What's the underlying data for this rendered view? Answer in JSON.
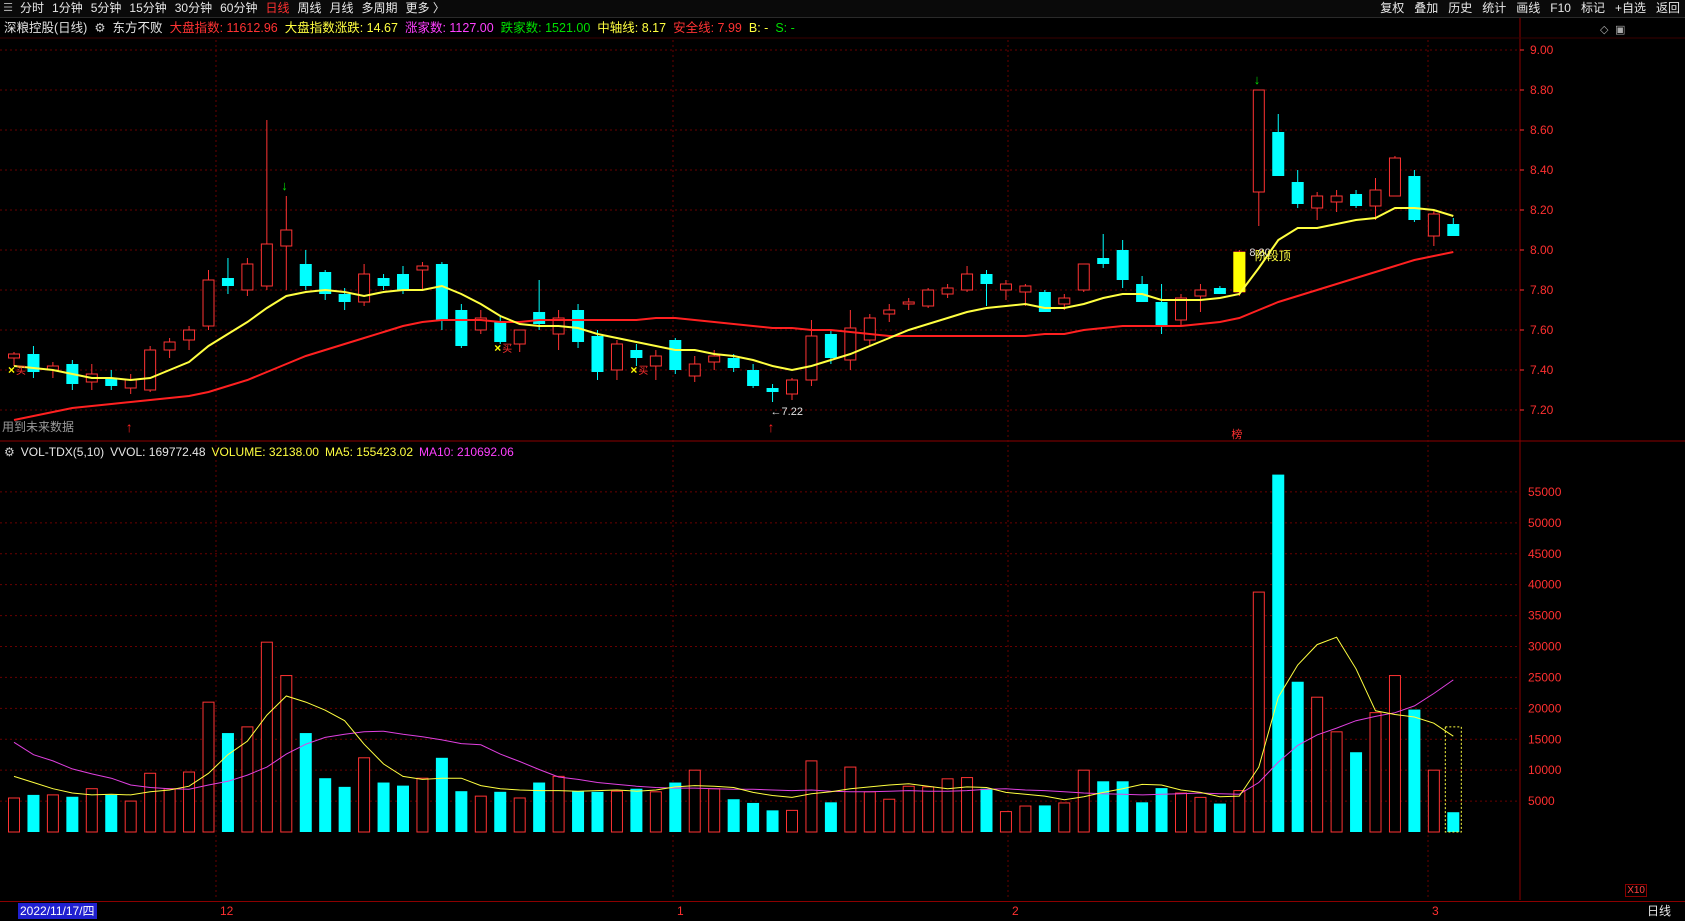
{
  "topbar": {
    "menu_icon": "menu-icon",
    "periods": [
      "分时",
      "1分钟",
      "5分钟",
      "15分钟",
      "30分钟",
      "60分钟",
      "日线",
      "周线",
      "月线",
      "多周期",
      "更多 〉"
    ],
    "active_period": "日线",
    "right_buttons": [
      "复权",
      "叠加",
      "历史",
      "统计",
      "画线",
      "F10",
      "标记",
      "+自选",
      "返回"
    ]
  },
  "infobar": {
    "stock": "深粮控股(日线)",
    "indicator": "东方不败",
    "index_label": "大盘指数: 11612.96",
    "index_change": "大盘指数涨跌: 14.67",
    "up_count": "涨家数: 1127.00",
    "down_count": "跌家数: 1521.00",
    "mid_line": "中轴线: 8.17",
    "safe_line": "安全线: 7.99",
    "b": "B: -",
    "s": "S: -"
  },
  "volbar": {
    "indicator": "VOL-TDX(5,10)",
    "vvol": "VVOL: 169772.48",
    "volume": "VOLUME: 32138.00",
    "ma5": "MA5: 155423.02",
    "ma10": "MA10: 210692.06"
  },
  "notes": {
    "future_data": "用到未来数据",
    "low_label": "←7.22",
    "high_label": "8.80",
    "stage_top": "阶段顶",
    "bang": "榜",
    "buy_marker": "买"
  },
  "bottombar": {
    "date": "2022/11/17/四",
    "ticks": [
      "12",
      "1",
      "2",
      "3"
    ],
    "period": "日线",
    "x10": "X10"
  },
  "price_axis": [
    "9.00",
    "8.80",
    "8.60",
    "8.40",
    "8.20",
    "8.00",
    "7.80",
    "7.60",
    "7.40",
    "7.20"
  ],
  "volume_axis": [
    "55000",
    "50000",
    "45000",
    "40000",
    "35000",
    "30000",
    "25000",
    "20000",
    "15000",
    "10000",
    "5000"
  ],
  "colors": {
    "up": "#ff3333",
    "down": "#00ffff",
    "ma_short": "#ffff40",
    "ma_long": "#ff2020",
    "vol_ma5": "#ffff40",
    "vol_ma10": "#e040e0",
    "grid": "#6a0000"
  },
  "chart_data": {
    "type": "candlestick",
    "price_range": [
      7.05,
      9.05
    ],
    "volume_range": [
      0,
      60000
    ],
    "candles": [
      [
        7.46,
        7.49,
        7.42,
        7.48,
        5500
      ],
      [
        7.48,
        7.52,
        7.36,
        7.39,
        6000
      ],
      [
        7.4,
        7.44,
        7.36,
        7.42,
        6000
      ],
      [
        7.43,
        7.45,
        7.3,
        7.33,
        5700
      ],
      [
        7.34,
        7.43,
        7.3,
        7.38,
        7000
      ],
      [
        7.36,
        7.4,
        7.3,
        7.32,
        6000
      ],
      [
        7.31,
        7.38,
        7.28,
        7.35,
        5000
      ],
      [
        7.3,
        7.52,
        7.29,
        7.5,
        9500
      ],
      [
        7.5,
        7.56,
        7.46,
        7.54,
        7000
      ],
      [
        7.55,
        7.62,
        7.5,
        7.6,
        9700
      ],
      [
        7.62,
        7.9,
        7.6,
        7.85,
        21000
      ],
      [
        7.86,
        7.96,
        7.78,
        7.82,
        16000
      ],
      [
        7.8,
        7.96,
        7.77,
        7.93,
        17000
      ],
      [
        7.82,
        8.65,
        7.8,
        8.03,
        30700
      ],
      [
        8.02,
        8.27,
        7.8,
        8.1,
        25300
      ],
      [
        7.93,
        8.0,
        7.8,
        7.82,
        16000
      ],
      [
        7.89,
        7.9,
        7.75,
        7.78,
        8700
      ],
      [
        7.78,
        7.81,
        7.7,
        7.74,
        7300
      ],
      [
        7.74,
        7.93,
        7.72,
        7.88,
        12000
      ],
      [
        7.86,
        7.88,
        7.8,
        7.82,
        8000
      ],
      [
        7.88,
        7.92,
        7.78,
        7.8,
        7500
      ],
      [
        7.9,
        7.94,
        7.8,
        7.92,
        8700
      ],
      [
        7.93,
        7.94,
        7.6,
        7.65,
        12000
      ],
      [
        7.7,
        7.73,
        7.51,
        7.52,
        6600
      ],
      [
        7.6,
        7.7,
        7.58,
        7.66,
        5800
      ],
      [
        7.64,
        7.67,
        7.53,
        7.54,
        6500
      ],
      [
        7.53,
        7.6,
        7.49,
        7.6,
        5500
      ],
      [
        7.69,
        7.85,
        7.6,
        7.63,
        8000
      ],
      [
        7.58,
        7.7,
        7.5,
        7.66,
        9000
      ],
      [
        7.7,
        7.73,
        7.51,
        7.54,
        6600
      ],
      [
        7.57,
        7.6,
        7.35,
        7.39,
        6500
      ],
      [
        7.4,
        7.55,
        7.35,
        7.53,
        6600
      ],
      [
        7.5,
        7.53,
        7.42,
        7.46,
        7000
      ],
      [
        7.42,
        7.5,
        7.35,
        7.47,
        6500
      ],
      [
        7.55,
        7.56,
        7.38,
        7.4,
        8000
      ],
      [
        7.37,
        7.47,
        7.34,
        7.43,
        10000
      ],
      [
        7.44,
        7.5,
        7.4,
        7.47,
        7000
      ],
      [
        7.46,
        7.48,
        7.39,
        7.41,
        5300
      ],
      [
        7.4,
        7.43,
        7.31,
        7.32,
        4700
      ],
      [
        7.31,
        7.33,
        7.24,
        7.29,
        3500
      ],
      [
        7.28,
        7.36,
        7.25,
        7.35,
        3500
      ],
      [
        7.35,
        7.65,
        7.32,
        7.57,
        11500
      ],
      [
        7.58,
        7.6,
        7.43,
        7.46,
        4800
      ],
      [
        7.45,
        7.7,
        7.4,
        7.61,
        10500
      ],
      [
        7.55,
        7.68,
        7.52,
        7.66,
        6500
      ],
      [
        7.68,
        7.73,
        7.64,
        7.7,
        5300
      ],
      [
        7.73,
        7.76,
        7.7,
        7.74,
        7400
      ],
      [
        7.72,
        7.81,
        7.71,
        7.8,
        7300
      ],
      [
        7.78,
        7.83,
        7.76,
        7.81,
        8600
      ],
      [
        7.8,
        7.92,
        7.79,
        7.88,
        8800
      ],
      [
        7.88,
        7.9,
        7.72,
        7.83,
        7000
      ],
      [
        7.8,
        7.85,
        7.75,
        7.83,
        3300
      ],
      [
        7.79,
        7.83,
        7.72,
        7.82,
        4200
      ],
      [
        7.79,
        7.8,
        7.7,
        7.69,
        4300
      ],
      [
        7.73,
        7.78,
        7.7,
        7.76,
        4700
      ],
      [
        7.8,
        7.92,
        7.79,
        7.93,
        10000
      ],
      [
        7.96,
        8.08,
        7.91,
        7.93,
        8200
      ],
      [
        8.0,
        8.05,
        7.81,
        7.85,
        8200
      ],
      [
        7.83,
        7.87,
        7.74,
        7.74,
        4800
      ],
      [
        7.74,
        7.83,
        7.58,
        7.62,
        7100
      ],
      [
        7.65,
        7.78,
        7.62,
        7.76,
        6300
      ],
      [
        7.77,
        7.83,
        7.69,
        7.8,
        5600
      ],
      [
        7.81,
        7.82,
        7.78,
        7.78,
        4600
      ],
      [
        7.79,
        8.0,
        7.77,
        7.99,
        6700
      ],
      [
        8.29,
        8.8,
        8.12,
        8.8,
        38800
      ],
      [
        8.59,
        8.68,
        8.37,
        8.37,
        57800
      ],
      [
        8.34,
        8.4,
        8.21,
        8.23,
        24300
      ],
      [
        8.21,
        8.29,
        8.15,
        8.27,
        21800
      ],
      [
        8.24,
        8.3,
        8.19,
        8.27,
        16200
      ],
      [
        8.28,
        8.3,
        8.21,
        8.22,
        12900
      ],
      [
        8.22,
        8.36,
        8.15,
        8.3,
        19300
      ],
      [
        8.27,
        8.47,
        8.27,
        8.46,
        25300
      ],
      [
        8.37,
        8.4,
        8.14,
        8.15,
        19800
      ],
      [
        8.07,
        8.2,
        8.02,
        8.18,
        10000
      ],
      [
        8.13,
        8.16,
        8.07,
        8.07,
        3200
      ]
    ],
    "ma_short": [
      7.42,
      7.41,
      7.4,
      7.38,
      7.36,
      7.36,
      7.35,
      7.36,
      7.4,
      7.44,
      7.52,
      7.58,
      7.64,
      7.71,
      7.77,
      7.79,
      7.8,
      7.79,
      7.77,
      7.79,
      7.8,
      7.8,
      7.82,
      7.78,
      7.73,
      7.67,
      7.63,
      7.62,
      7.62,
      7.61,
      7.58,
      7.56,
      7.54,
      7.52,
      7.5,
      7.5,
      7.48,
      7.47,
      7.45,
      7.42,
      7.4,
      7.42,
      7.45,
      7.48,
      7.52,
      7.56,
      7.6,
      7.63,
      7.66,
      7.69,
      7.71,
      7.72,
      7.73,
      7.71,
      7.71,
      7.73,
      7.76,
      7.78,
      7.78,
      7.75,
      7.75,
      7.75,
      7.76,
      7.78,
      7.91,
      8.05,
      8.11,
      8.11,
      8.13,
      8.15,
      8.16,
      8.21,
      8.21,
      8.2,
      8.17
    ],
    "ma_long": [
      7.15,
      7.17,
      7.19,
      7.21,
      7.22,
      7.23,
      7.24,
      7.25,
      7.26,
      7.27,
      7.29,
      7.32,
      7.35,
      7.39,
      7.43,
      7.47,
      7.5,
      7.53,
      7.56,
      7.59,
      7.62,
      7.64,
      7.65,
      7.65,
      7.65,
      7.64,
      7.64,
      7.65,
      7.65,
      7.65,
      7.65,
      7.65,
      7.65,
      7.66,
      7.66,
      7.65,
      7.64,
      7.63,
      7.62,
      7.61,
      7.61,
      7.6,
      7.6,
      7.59,
      7.58,
      7.57,
      7.57,
      7.57,
      7.57,
      7.57,
      7.57,
      7.57,
      7.57,
      7.58,
      7.58,
      7.6,
      7.61,
      7.62,
      7.62,
      7.62,
      7.62,
      7.63,
      7.64,
      7.66,
      7.7,
      7.74,
      7.77,
      7.8,
      7.83,
      7.86,
      7.89,
      7.92,
      7.95,
      7.97,
      7.99
    ],
    "vol_ma5": [
      9000,
      8000,
      7000,
      6300,
      6000,
      6100,
      6000,
      6500,
      6800,
      7400,
      9500,
      12500,
      14700,
      18900,
      22000,
      21000,
      19700,
      18000,
      14200,
      11000,
      9000,
      8500,
      8700,
      8700,
      7500,
      7000,
      6800,
      6700,
      6700,
      6600,
      6700,
      6800,
      6600,
      6800,
      7300,
      7500,
      7400,
      7200,
      6400,
      5900,
      5600,
      6200,
      6500,
      7000,
      7300,
      7600,
      7800,
      7400,
      7000,
      7300,
      7200,
      6400,
      6100,
      5800,
      5200,
      5700,
      6400,
      7000,
      7700,
      7600,
      6800,
      6400,
      5700,
      5800,
      10500,
      21800,
      27000,
      30300,
      31500,
      26400,
      19600,
      19000,
      18600,
      17600,
      15500
    ],
    "vol_ma10": [
      14500,
      12500,
      11500,
      10200,
      9400,
      8700,
      7600,
      7200,
      7000,
      6900,
      7600,
      8200,
      9200,
      10500,
      12600,
      14200,
      15300,
      15800,
      16200,
      16300,
      15800,
      15400,
      14900,
      14300,
      14100,
      12600,
      11400,
      10100,
      8900,
      8500,
      8000,
      7700,
      7400,
      7200,
      7100,
      7100,
      7000,
      6900,
      6900,
      6800,
      6700,
      6800,
      6600,
      6500,
      6500,
      6600,
      6700,
      6600,
      6600,
      6700,
      6900,
      7000,
      6800,
      6700,
      6500,
      6300,
      6200,
      6100,
      6000,
      6100,
      6200,
      6300,
      6200,
      6100,
      8000,
      11300,
      14000,
      15700,
      16800,
      18000,
      18700,
      19300,
      20400,
      22400,
      24600
    ],
    "signals": {
      "buy_x": [
        0,
        25,
        32
      ],
      "red_up_arrow": [
        6,
        39
      ],
      "green_down_arrow": [
        14,
        64
      ],
      "low_point": 39,
      "high_point": 63
    }
  }
}
